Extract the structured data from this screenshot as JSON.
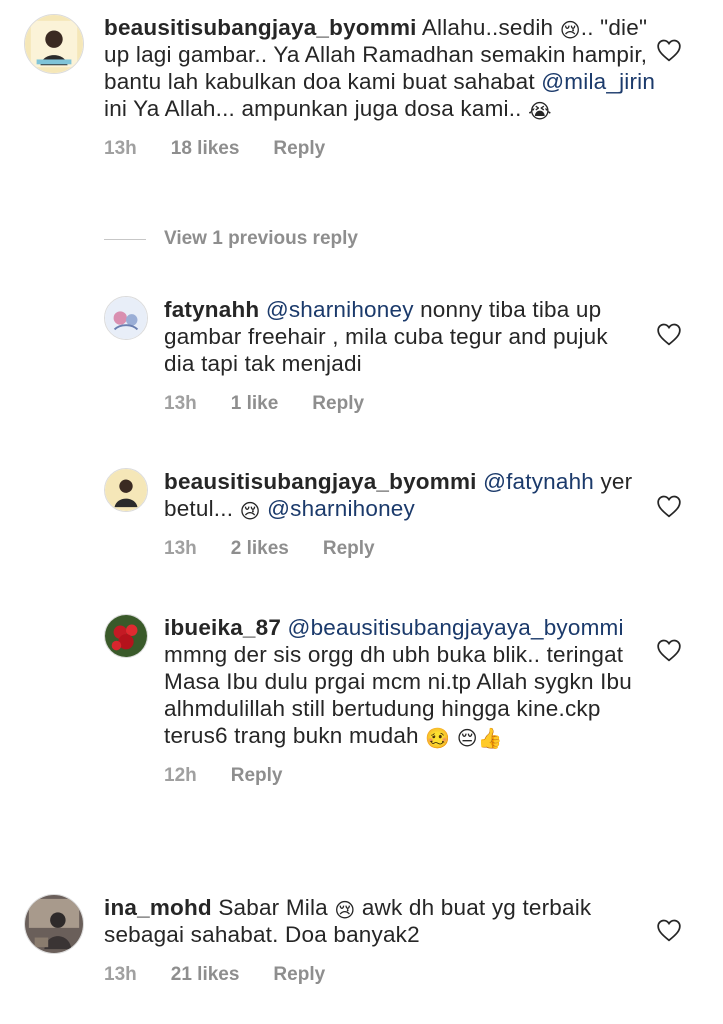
{
  "comments": [
    {
      "username": "beausitisubangjaya_byommi",
      "text_parts": [
        {
          "t": "Allahu..sedih "
        },
        {
          "e": "😢"
        },
        {
          "t": ".. \"die\" up lagi gambar.. Ya Allah Ramadhan semakin hampir, bantu lah kabulkan doa kami buat sahabat "
        },
        {
          "m": "@mila_jirin"
        },
        {
          "t": " ini Ya Allah... ampunkan juga dosa kami.. "
        },
        {
          "e": "😭"
        }
      ],
      "time": "13h",
      "likes": "18 likes",
      "reply": "Reply"
    },
    {
      "username": "fatynahh",
      "text_parts": [
        {
          "m": "@sharnihoney"
        },
        {
          "t": " nonny tiba tiba up gambar freehair , mila cuba tegur and pujuk dia tapi tak menjadi"
        }
      ],
      "time": "13h",
      "likes": "1 like",
      "reply": "Reply"
    },
    {
      "username": "beausitisubangjaya_byommi",
      "text_parts": [
        {
          "m": "@fatynahh"
        },
        {
          "t": " yer betul... "
        },
        {
          "e": "😢"
        },
        {
          "t": " "
        },
        {
          "m": "@sharnihoney"
        }
      ],
      "time": "13h",
      "likes": "2 likes",
      "reply": "Reply"
    },
    {
      "username": "ibueika_87",
      "text_parts": [
        {
          "m": "@beausitisubangjayaya_byommi"
        },
        {
          "t": " mmng der sis orgg dh ubh buka blik.. teringat Masa Ibu dulu prgai mcm ni.tp Allah sygkn Ibu alhmdulillah still bertudung hingga kine.ckp terus6 trang bukn mudah "
        },
        {
          "e": "🥴"
        },
        {
          "t": " "
        },
        {
          "e": "😔"
        },
        {
          "e": "👍"
        }
      ],
      "time": "12h",
      "likes": "",
      "reply": "Reply"
    },
    {
      "username": "ina_mohd",
      "text_parts": [
        {
          "t": "Sabar Mila "
        },
        {
          "e": "😢"
        },
        {
          "t": " awk dh buat yg terbaik sebagai sahabat. Doa banyak2"
        }
      ],
      "time": "13h",
      "likes": "21 likes",
      "reply": "Reply"
    }
  ],
  "view_replies": "View 1 previous reply",
  "colors": {
    "text": "#262626",
    "muted": "#8e8e8e",
    "mention": "#1b3a6b",
    "border": "#dbdbdb"
  },
  "icons": {
    "like": "heart-outline-icon"
  }
}
